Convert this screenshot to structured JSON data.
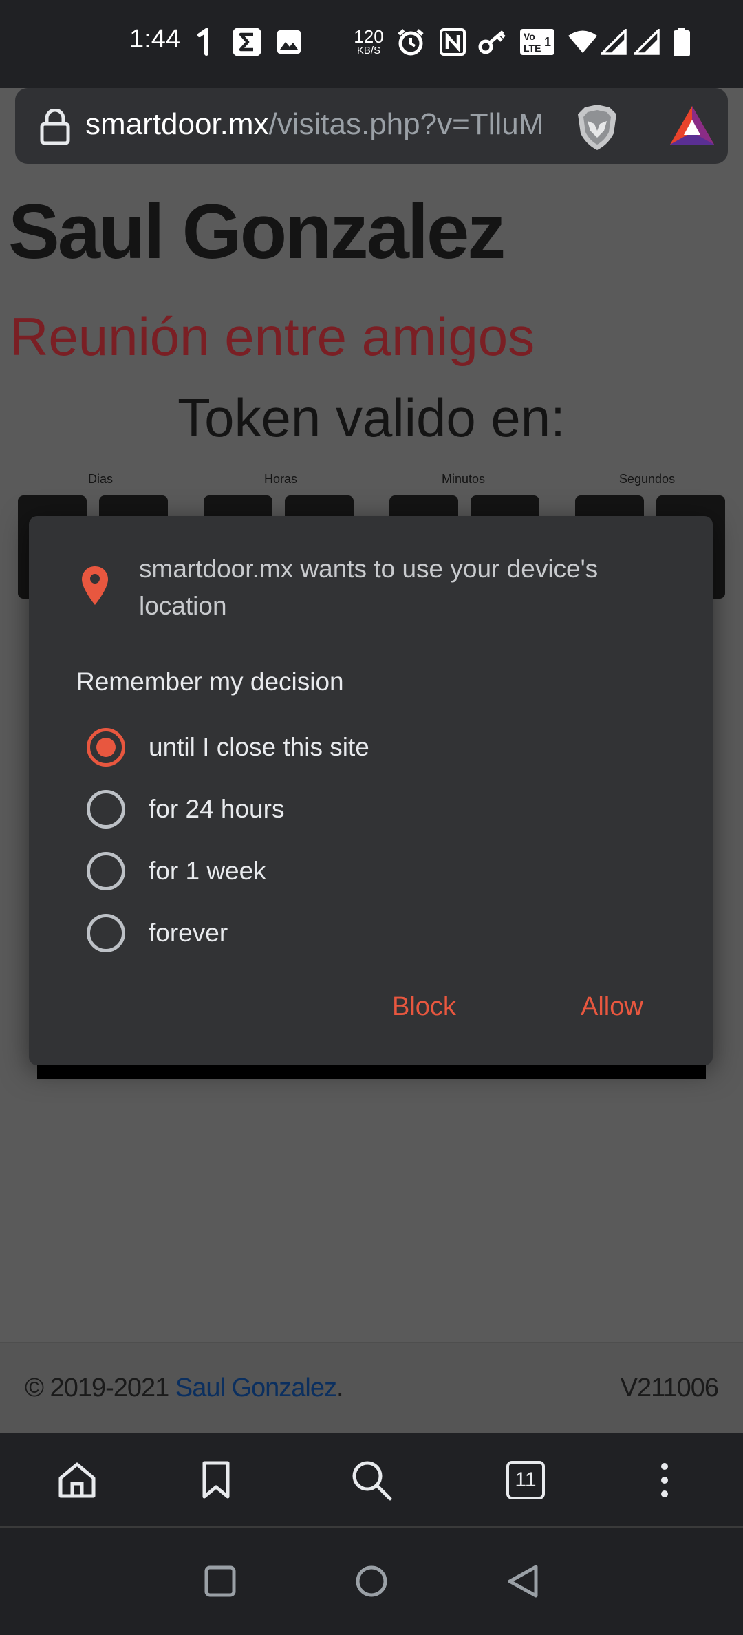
{
  "status_bar": {
    "time": "1:44",
    "net_speed_value": "120",
    "net_speed_unit": "KB/S",
    "icons": [
      "notification-1-icon",
      "sigma-app-icon",
      "image-icon",
      "alarm-icon",
      "nfc-icon",
      "key-icon",
      "volte-icon",
      "wifi-icon",
      "signal-icon",
      "signal-icon",
      "battery-icon"
    ]
  },
  "browser": {
    "url_domain": "smartdoor.mx",
    "url_path": "/visitas.php?v=TlluM",
    "tab_count": "11",
    "toolbar_icons": [
      "home-icon",
      "bookmark-icon",
      "search-icon",
      "tabs-icon",
      "menu-icon"
    ]
  },
  "page": {
    "title": "Saul Gonzalez",
    "subtitle": "Reunión entre amigos",
    "token_label": "Token valido en:",
    "countdown_labels": [
      "Dias",
      "Horas",
      "Minutos",
      "Segundos"
    ],
    "footer_copy_prefix": "© 2019-2021 ",
    "footer_link": "Saul Gonzalez",
    "footer_period": ".",
    "version": "V211006"
  },
  "dialog": {
    "message": "smartdoor.mx wants to use your device's location",
    "remember_label": "Remember my decision",
    "options": [
      {
        "label": "until I close this site",
        "checked": true
      },
      {
        "label": "for 24 hours",
        "checked": false
      },
      {
        "label": "for 1 week",
        "checked": false
      },
      {
        "label": "forever",
        "checked": false
      }
    ],
    "block_label": "Block",
    "allow_label": "Allow",
    "accent_color": "#e8573f"
  }
}
